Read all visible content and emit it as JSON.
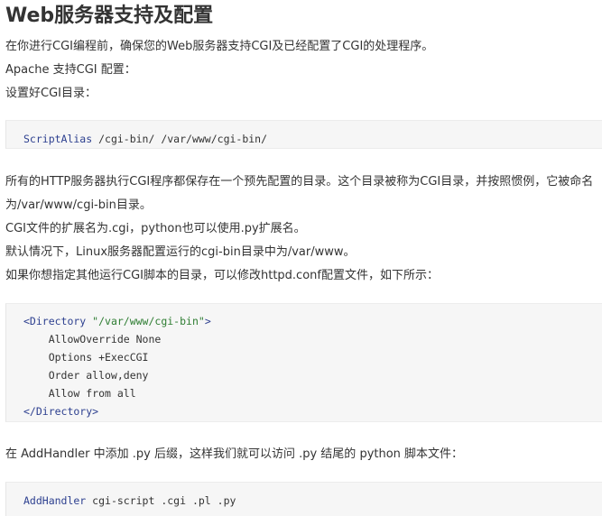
{
  "title": "Web服务器支持及配置",
  "paragraphs": {
    "p1": "在你进行CGI编程前，确保您的Web服务器支持CGI及已经配置了CGI的处理程序。",
    "p2": "Apache 支持CGI 配置：",
    "p3": "设置好CGI目录：",
    "p4": "所有的HTTP服务器执行CGI程序都保存在一个预先配置的目录。这个目录被称为CGI目录，并按照惯例，它被命名",
    "p5": "为/var/www/cgi-bin目录。",
    "p6": "CGI文件的扩展名为.cgi，python也可以使用.py扩展名。",
    "p7": "默认情况下，Linux服务器配置运行的cgi-bin目录中为/var/www。",
    "p8": "如果你想指定其他运行CGI脚本的目录，可以修改httpd.conf配置文件，如下所示：",
    "p9": "在 AddHandler 中添加 .py 后缀，这样我们就可以访问 .py 结尾的 python 脚本文件："
  },
  "code1": {
    "keyword": "ScriptAlias",
    "rest": " /cgi-bin/ /var/www/cgi-bin/"
  },
  "code2": {
    "open_tag": "<Directory",
    "open_value": " \"/var/www/cgi-bin\"",
    "open_close": ">",
    "line2": "    AllowOverride None",
    "line3": "    Options +ExecCGI",
    "line4": "    Order allow,deny",
    "line5": "    Allow from all",
    "close_tag": "</Directory>"
  },
  "code3": {
    "keyword": "AddHandler",
    "rest": " cgi-script .cgi .pl .py"
  },
  "colors": {
    "text": "#333333",
    "code_bg": "#f6f6f6",
    "keyword": "#2c3f8f",
    "string": "#2e7d32"
  }
}
